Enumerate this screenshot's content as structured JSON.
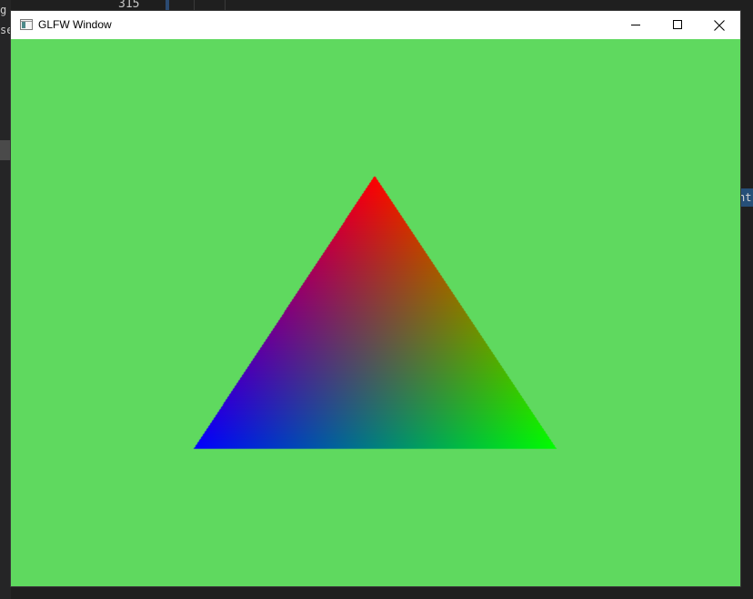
{
  "background_editor": {
    "left_text_lines": [
      "g",
      "se"
    ],
    "line_number": "315",
    "right_fragment": "nt"
  },
  "window": {
    "title": "GLFW Window",
    "icon": "app-window-icon",
    "controls": {
      "minimize_icon": "minimize-icon",
      "maximize_icon": "maximize-icon",
      "close_icon": "close-icon"
    }
  },
  "scene": {
    "clear_color": "#5fd95f",
    "triangle": {
      "vertex_colors": {
        "top": "#ff0000",
        "bottom_left": "#0000ff",
        "bottom_right": "#00ff00"
      }
    }
  }
}
